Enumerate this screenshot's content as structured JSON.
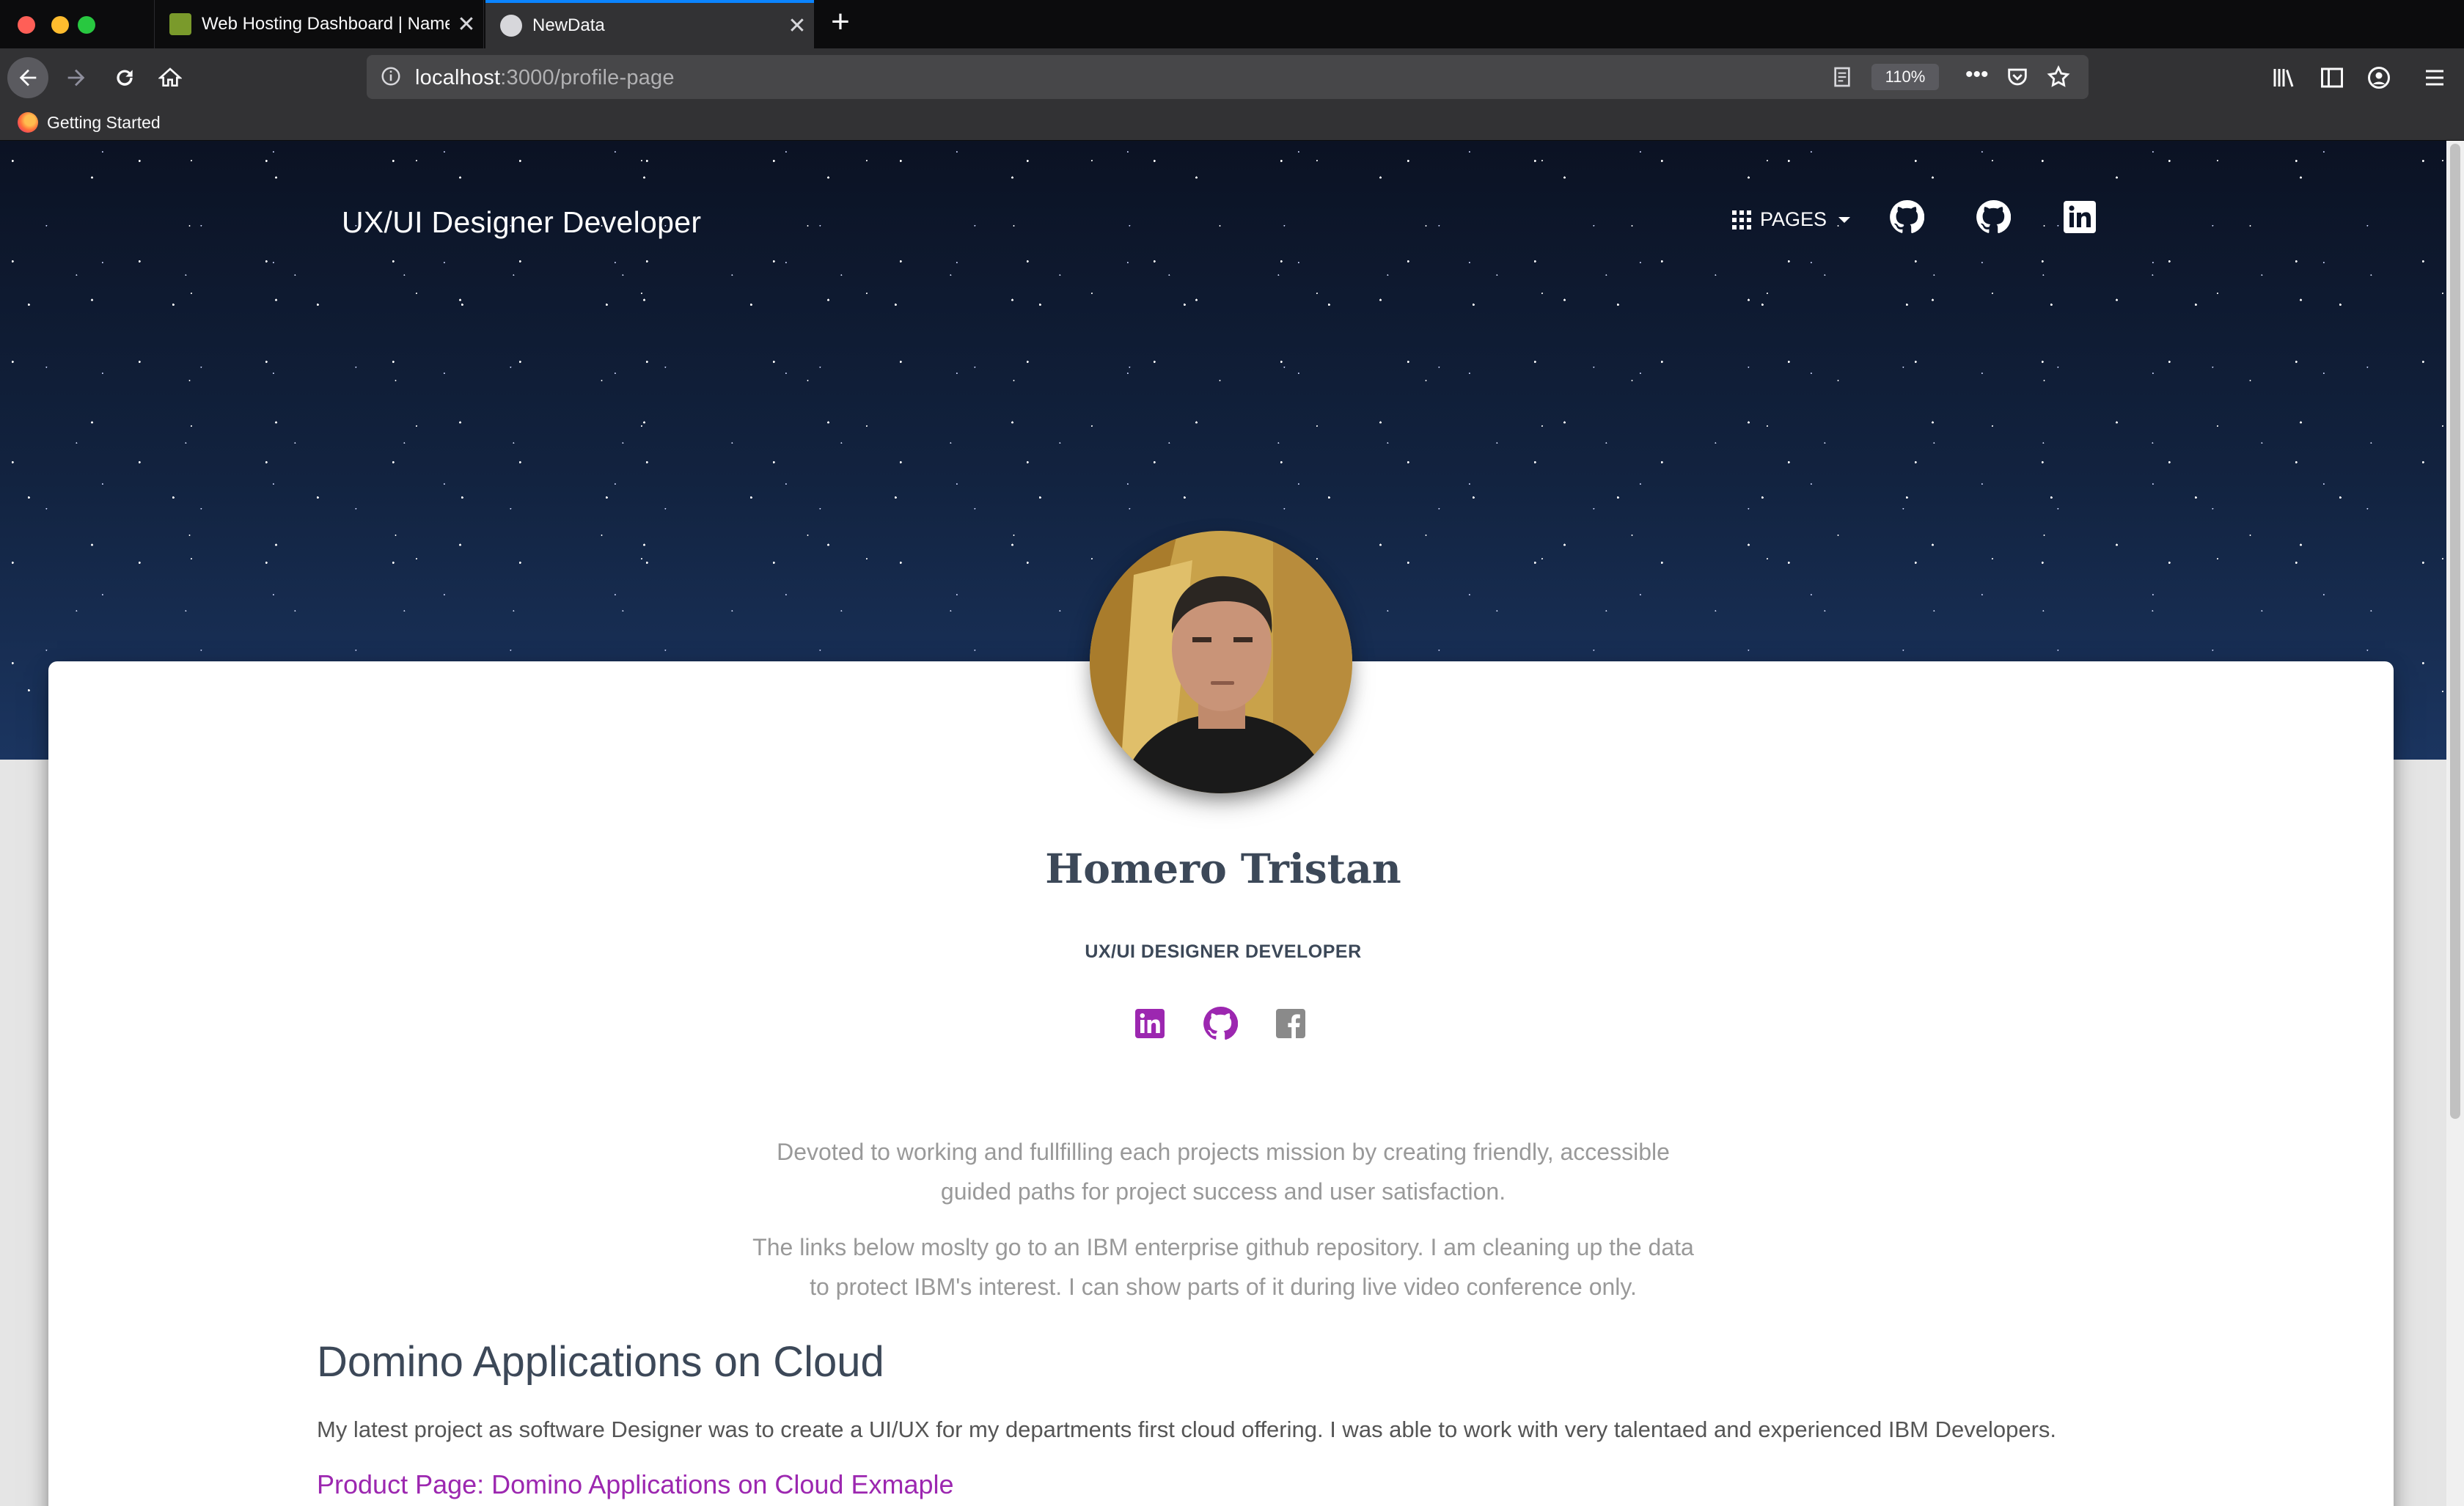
{
  "browser": {
    "tabs": [
      {
        "title": "Web Hosting Dashboard | Namecheap",
        "active": false
      },
      {
        "title": "NewData",
        "active": true
      }
    ],
    "url_host": "localhost",
    "url_path": ":3000/profile-page",
    "zoom": "110%",
    "bookmarks": [
      {
        "label": "Getting Started"
      }
    ]
  },
  "header": {
    "brand": "UX/UI Designer Developer",
    "pages_label": "PAGES",
    "social_icons": [
      "github-icon",
      "github-icon",
      "linkedin-icon"
    ]
  },
  "profile": {
    "name": "Homero Tristan",
    "title": "UX/UI DESIGNER DEVELOPER",
    "social_icons": [
      "linkedin-icon",
      "github-icon",
      "facebook-icon"
    ],
    "accent_color": "#9c27b0",
    "description": [
      "Devoted to working and fullfilling each projects mission by creating friendly, accessible guided paths for project success and user satisfaction.",
      "The links below moslty go to an IBM enterprise github repository. I am cleaning up the data to protect IBM's interest. I can show parts of it during live video conference only."
    ]
  },
  "section": {
    "heading": "Domino Applications on Cloud",
    "body": "My latest project as software Designer was to create a UI/UX for my departments first cloud offering. I was able to work with very talentaed and experienced IBM Developers.",
    "link": "Product Page: Domino Applications on Cloud Exmaple"
  }
}
